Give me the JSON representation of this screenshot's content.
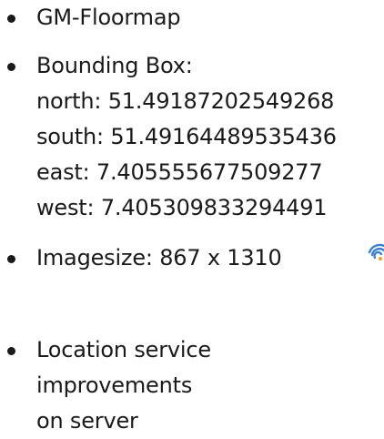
{
  "bullets": [
    {
      "lines": [
        "GM-Floormap"
      ]
    },
    {
      "lines": [
        "Bounding Box:",
        "north: 51.49187202549268",
        "south: 51.49164489535436",
        "east: 7.405555677509277",
        "west: 7.405309833294491"
      ]
    },
    {
      "lines": [
        "Imagesize: 867 x 1310"
      ]
    },
    {
      "lines": [
        "Location service",
        "improvements",
        "on server"
      ]
    }
  ],
  "icons": {
    "wifi": "wifi-icon"
  },
  "colors": {
    "text": "#1a1a1a",
    "wifi_blue": "#3a7fd0",
    "wifi_orange": "#f0a020"
  }
}
